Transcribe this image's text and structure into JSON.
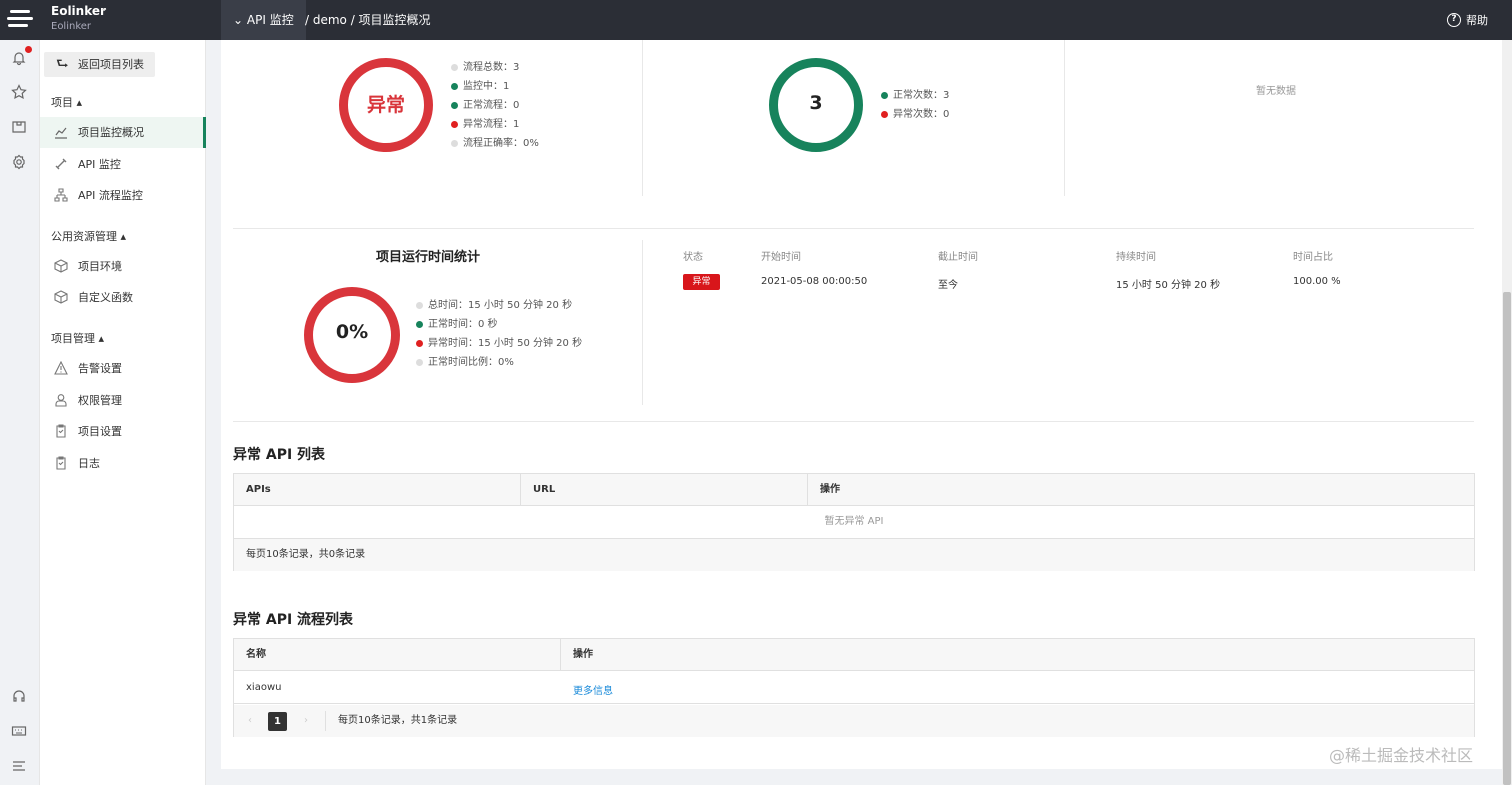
{
  "topbar": {
    "brand_name": "Eolinker",
    "brand_sub": "Eolinker",
    "module_label": "API 监控",
    "breadcrumb": "/ demo / 项目监控概况",
    "help_label": "帮助"
  },
  "sidebar": {
    "back_label": "返回项目列表",
    "group_project": "项目 ▴",
    "group_resources": "公用资源管理 ▴",
    "group_manage": "项目管理 ▴",
    "items": [
      {
        "label": "项目监控概况",
        "icon": "chart-line-icon"
      },
      {
        "label": "API 监控",
        "icon": "api-icon"
      },
      {
        "label": "API 流程监控",
        "icon": "flow-icon"
      },
      {
        "label": "项目环境",
        "icon": "cube-icon"
      },
      {
        "label": "自定义函数",
        "icon": "cube-icon"
      },
      {
        "label": "告警设置",
        "icon": "warning-icon"
      },
      {
        "label": "权限管理",
        "icon": "user-icon"
      },
      {
        "label": "项目设置",
        "icon": "clipboard-icon"
      },
      {
        "label": "日志",
        "icon": "clipboard-icon"
      }
    ]
  },
  "flow_stats": {
    "ring_label": "异常",
    "legend": [
      "流程总数：3",
      "监控中：1",
      "正常流程：0",
      "异常流程：1",
      "流程正确率：0%"
    ]
  },
  "count_stats": {
    "ring_label": "3",
    "legend": [
      "正常次数：3",
      "异常次数：0"
    ]
  },
  "empty_panel": {
    "nodata": "暂无数据"
  },
  "runtime": {
    "title": "项目运行时间统计",
    "ring_label": "0%",
    "legend": [
      "总时间：15 小时 50 分钟 20 秒",
      "正常时间：0 秒",
      "异常时间：15 小时 50 分钟 20 秒",
      "正常时间比例：0%"
    ],
    "headers": [
      "状态",
      "开始时间",
      "截止时间",
      "持续时间",
      "时间占比"
    ],
    "row": {
      "status": "异常",
      "start": "2021-05-08 00:00:50",
      "end": "至今",
      "duration": "15 小时 50 分钟 20 秒",
      "ratio": "100.00 %"
    }
  },
  "api_list": {
    "title": "异常 API 列表",
    "headers": [
      "APIs",
      "URL",
      "操作"
    ],
    "empty": "暂无异常 API",
    "footer": "每页10条记录，共0条记录"
  },
  "flow_list": {
    "title": "异常 API 流程列表",
    "headers": [
      "名称",
      "操作"
    ],
    "rows": [
      {
        "name": "xiaowu",
        "action": "更多信息"
      }
    ],
    "page": "1",
    "footer": "每页10条记录，共1条记录"
  },
  "watermark": "@稀土掘金技术社区",
  "colors": {
    "topbar": "#2b2e36",
    "accent_green": "#17835c",
    "danger_red": "#d8161b",
    "link_blue": "#1a8ad9"
  }
}
